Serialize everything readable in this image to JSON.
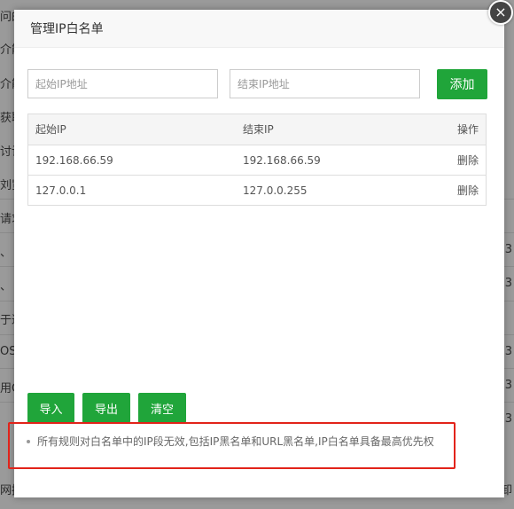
{
  "background": {
    "left_items": [
      "问的",
      "介能",
      "介能",
      "获取",
      "讨计",
      "刘览",
      "请求",
      "、",
      "、",
      "于过",
      "OST",
      "用C",
      "网拦"
    ],
    "right_items": [
      "3",
      "3",
      "3",
      "3",
      "3",
      "卸"
    ]
  },
  "modal": {
    "title": "管理IP白名单",
    "start_ip_placeholder": "起始IP地址",
    "end_ip_placeholder": "结束IP地址",
    "add_label": "添加",
    "table": {
      "headers": [
        "起始IP",
        "结束IP",
        "操作"
      ],
      "rows": [
        {
          "start": "192.168.66.59",
          "end": "192.168.66.59",
          "action": "删除"
        },
        {
          "start": "127.0.0.1",
          "end": "127.0.0.255",
          "action": "删除"
        }
      ]
    },
    "import_label": "导入",
    "export_label": "导出",
    "clear_label": "清空",
    "tip": "所有规则对白名单中的IP段无效,包括IP黑名单和URL黑名单,IP白名单具备最高优先权"
  },
  "colors": {
    "accent": "#20a53a",
    "highlight": "#e2231a"
  }
}
